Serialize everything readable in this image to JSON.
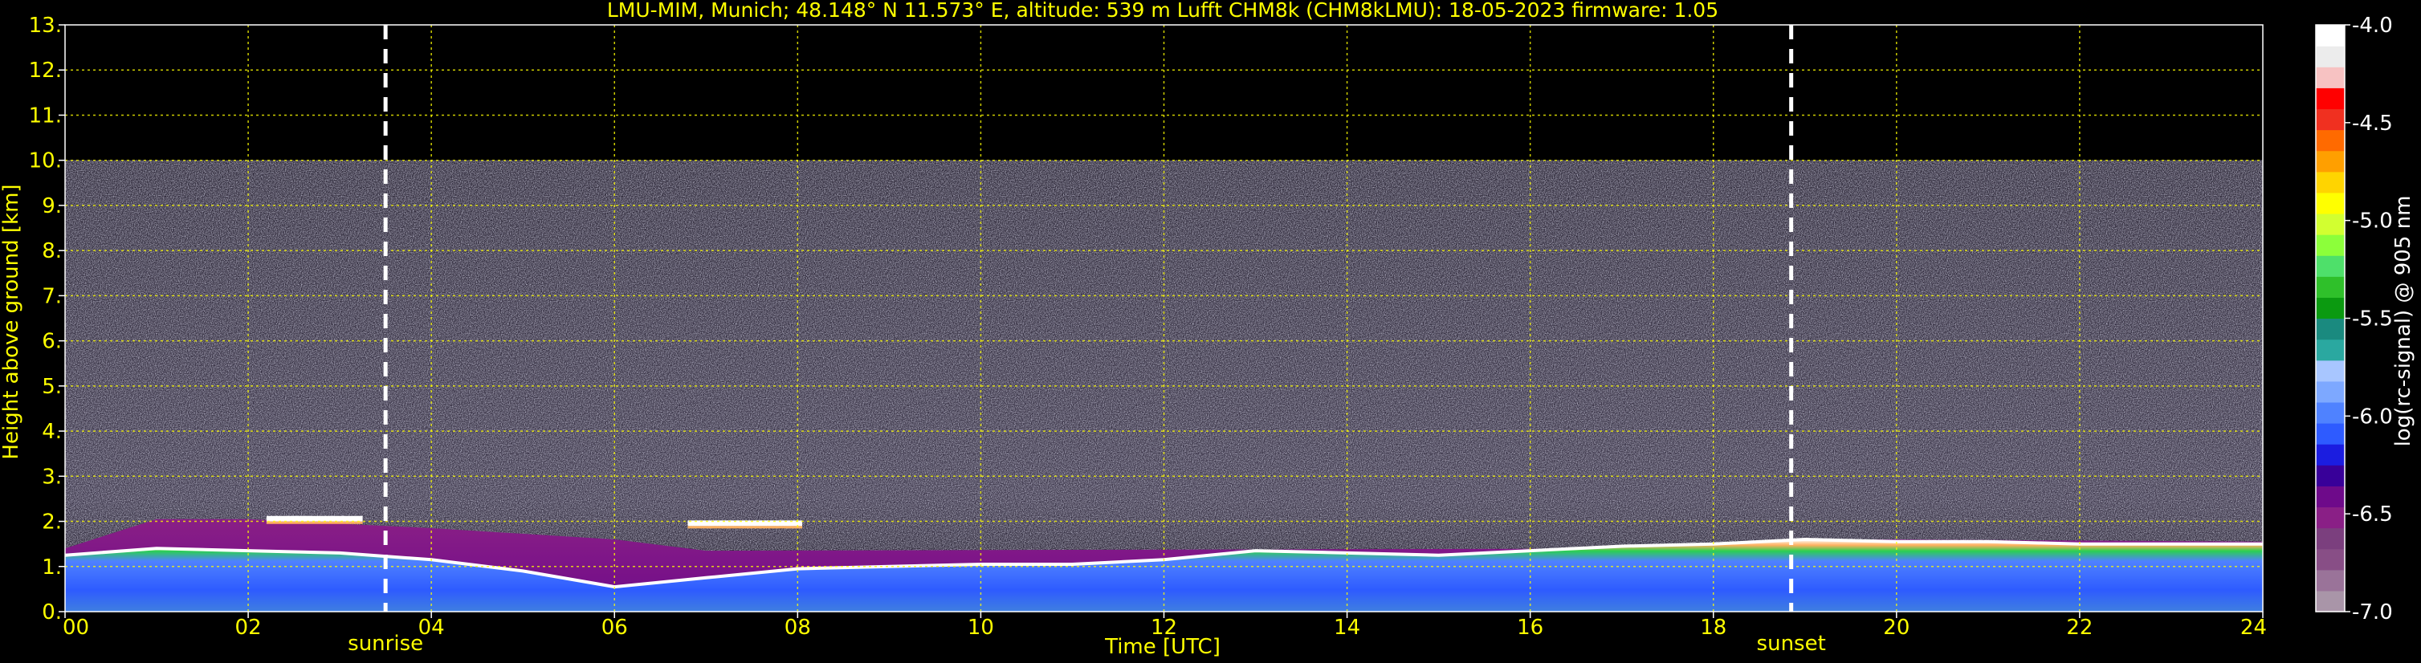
{
  "chart_data": {
    "type": "heatmap",
    "title": "LMU-MIM, Munich; 48.148° N 11.573° E, altitude: 539 m    Lufft CHM8k (CHM8kLMU): 18-05-2023    firmware: 1.05",
    "xlabel": "Time [UTC]",
    "ylabel": "Height above ground [km]",
    "xlim": [
      0,
      24
    ],
    "ylim": [
      0,
      13
    ],
    "x_ticks": [
      "00",
      "02",
      "04",
      "06",
      "08",
      "10",
      "12",
      "14",
      "16",
      "18",
      "20",
      "22",
      "24"
    ],
    "y_ticks": [
      "0.",
      "1.",
      "2.",
      "3.",
      "4.",
      "5.",
      "6.",
      "7.",
      "8.",
      "9.",
      "10.",
      "11.",
      "12.",
      "13."
    ],
    "grid": true,
    "max_range_km": 10,
    "colorbar": {
      "label": "log(rc-signal) @ 905 nm",
      "range": [
        -7.0,
        -4.0
      ],
      "ticks": [
        "-4.0",
        "-4.5",
        "-5.0",
        "-5.5",
        "-6.0",
        "-6.5",
        "-7.0"
      ],
      "colors": [
        "#a995a8",
        "#9a7399",
        "#884e86",
        "#7b3f7e",
        "#8a1f86",
        "#6e0a8a",
        "#380099",
        "#1b1de0",
        "#2e5bff",
        "#4f82ff",
        "#7da8ff",
        "#a8c6ff",
        "#2aa8a0",
        "#1a8a7f",
        "#0b9a10",
        "#2fc02a",
        "#4ee06a",
        "#8cff3a",
        "#d2ff30",
        "#ffff00",
        "#ffd400",
        "#ff9f00",
        "#ff6a00",
        "#f03020",
        "#ff0000",
        "#f7c2c2",
        "#ececec",
        "#ffffff"
      ]
    },
    "events": [
      {
        "label": "sunrise",
        "time_h": 3.5
      },
      {
        "label": "sunset",
        "time_h": 18.85
      }
    ],
    "cloud_layers": [
      {
        "start_h": 2.2,
        "end_h": 3.25,
        "height_km": 2.05
      },
      {
        "start_h": 6.8,
        "end_h": 8.05,
        "height_km": 1.95
      }
    ],
    "boundary_layer_top_km": [
      [
        0.0,
        1.25
      ],
      [
        1.0,
        1.4
      ],
      [
        2.0,
        1.35
      ],
      [
        3.0,
        1.3
      ],
      [
        4.0,
        1.15
      ],
      [
        5.0,
        0.9
      ],
      [
        6.0,
        0.55
      ],
      [
        7.0,
        0.75
      ],
      [
        8.0,
        0.95
      ],
      [
        9.0,
        1.0
      ],
      [
        10.0,
        1.05
      ],
      [
        11.0,
        1.05
      ],
      [
        12.0,
        1.15
      ],
      [
        13.0,
        1.35
      ],
      [
        14.0,
        1.3
      ],
      [
        15.0,
        1.25
      ],
      [
        16.0,
        1.35
      ],
      [
        17.0,
        1.45
      ],
      [
        18.0,
        1.5
      ],
      [
        19.0,
        1.6
      ],
      [
        20.0,
        1.55
      ],
      [
        21.0,
        1.55
      ],
      [
        22.0,
        1.5
      ],
      [
        23.0,
        1.5
      ],
      [
        24.0,
        1.5
      ]
    ],
    "residual_layer_top_km": [
      [
        0.0,
        1.4
      ],
      [
        1.0,
        2.05
      ],
      [
        2.0,
        2.05
      ],
      [
        4.0,
        1.85
      ],
      [
        6.0,
        1.6
      ],
      [
        7.0,
        1.35
      ],
      [
        17.5,
        1.4
      ],
      [
        18.85,
        1.6
      ],
      [
        20.0,
        1.6
      ],
      [
        24.0,
        1.55
      ]
    ]
  }
}
